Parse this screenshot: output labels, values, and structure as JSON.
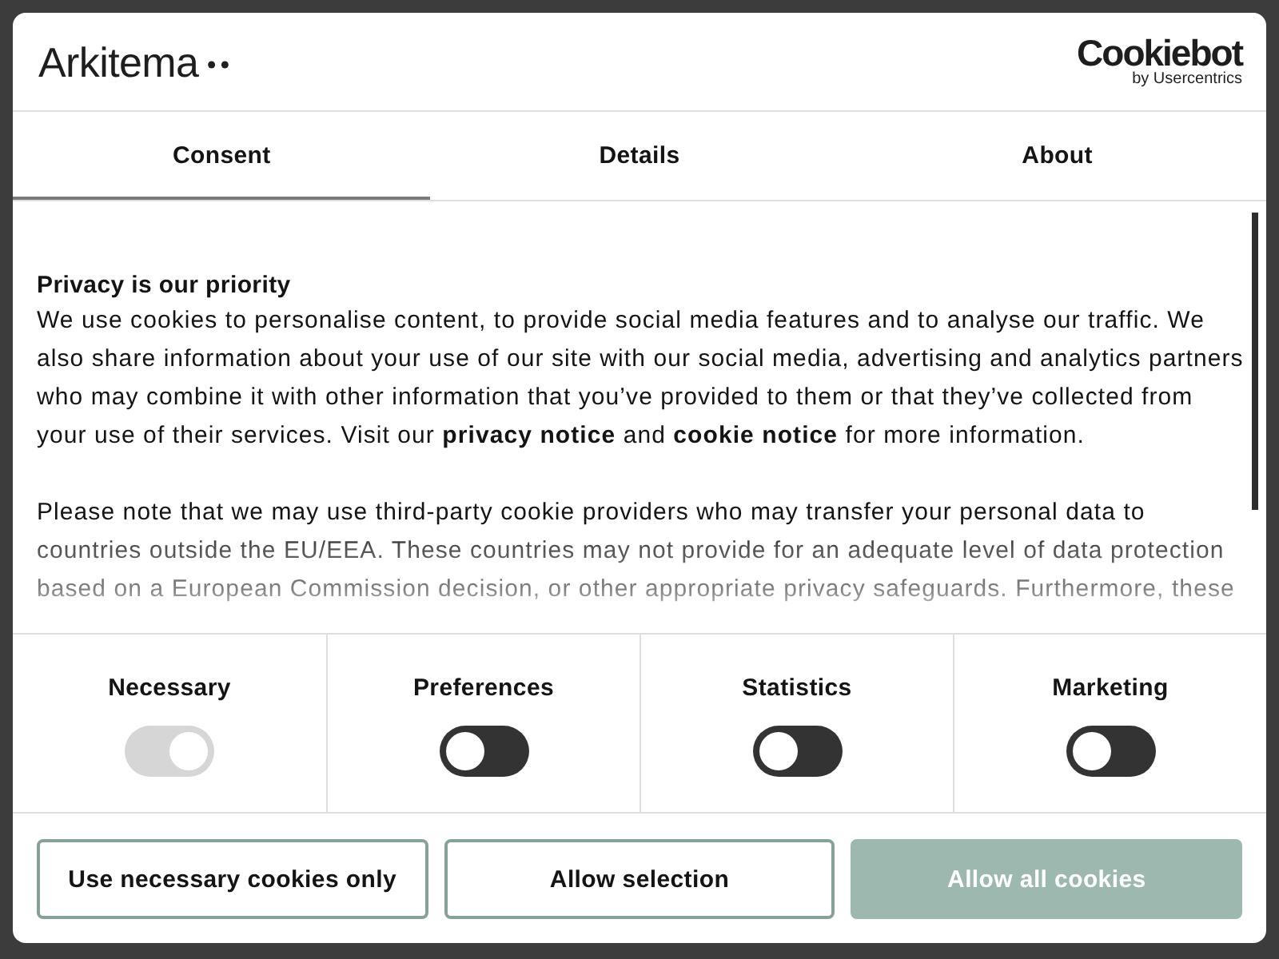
{
  "header": {
    "brand": "Arkitema",
    "provider": "Cookiebot",
    "provider_byline": "by Usercentrics"
  },
  "tabs": [
    {
      "label": "Consent",
      "selected": true
    },
    {
      "label": "Details",
      "selected": false
    },
    {
      "label": "About",
      "selected": false
    }
  ],
  "content": {
    "heading": "Privacy is our priority",
    "paragraphs": [
      [
        {
          "kind": "text",
          "text": "We use cookies to personalise content, to provide social media features and to analyse our traffic. We also share information about your use of our site with our social media, advertising and analytics partners who may combine it with other information that you’ve provided to them or that they’ve collected from your use of their services. Visit our "
        },
        {
          "kind": "link",
          "text": "privacy notice"
        },
        {
          "kind": "text",
          "text": " and "
        },
        {
          "kind": "link",
          "text": "cookie notice"
        },
        {
          "kind": "text",
          "text": " for more information."
        }
      ],
      [
        {
          "kind": "text",
          "text": "Please note that we may use third-party cookie providers who may transfer your personal data to countries outside the EU/EEA. These countries may not provide for an adequate level of data protection based on a European Commission decision, or other appropriate privacy safeguards. Furthermore, these"
        }
      ]
    ]
  },
  "categories": [
    {
      "label": "Necessary",
      "checked": true,
      "disabled": true
    },
    {
      "label": "Preferences",
      "checked": false,
      "disabled": false
    },
    {
      "label": "Statistics",
      "checked": false,
      "disabled": false
    },
    {
      "label": "Marketing",
      "checked": false,
      "disabled": false
    }
  ],
  "buttons": [
    {
      "label": "Use necessary cookies only",
      "kind": "outline"
    },
    {
      "label": "Allow selection",
      "kind": "outline"
    },
    {
      "label": "Allow all cookies",
      "kind": "filled"
    }
  ]
}
